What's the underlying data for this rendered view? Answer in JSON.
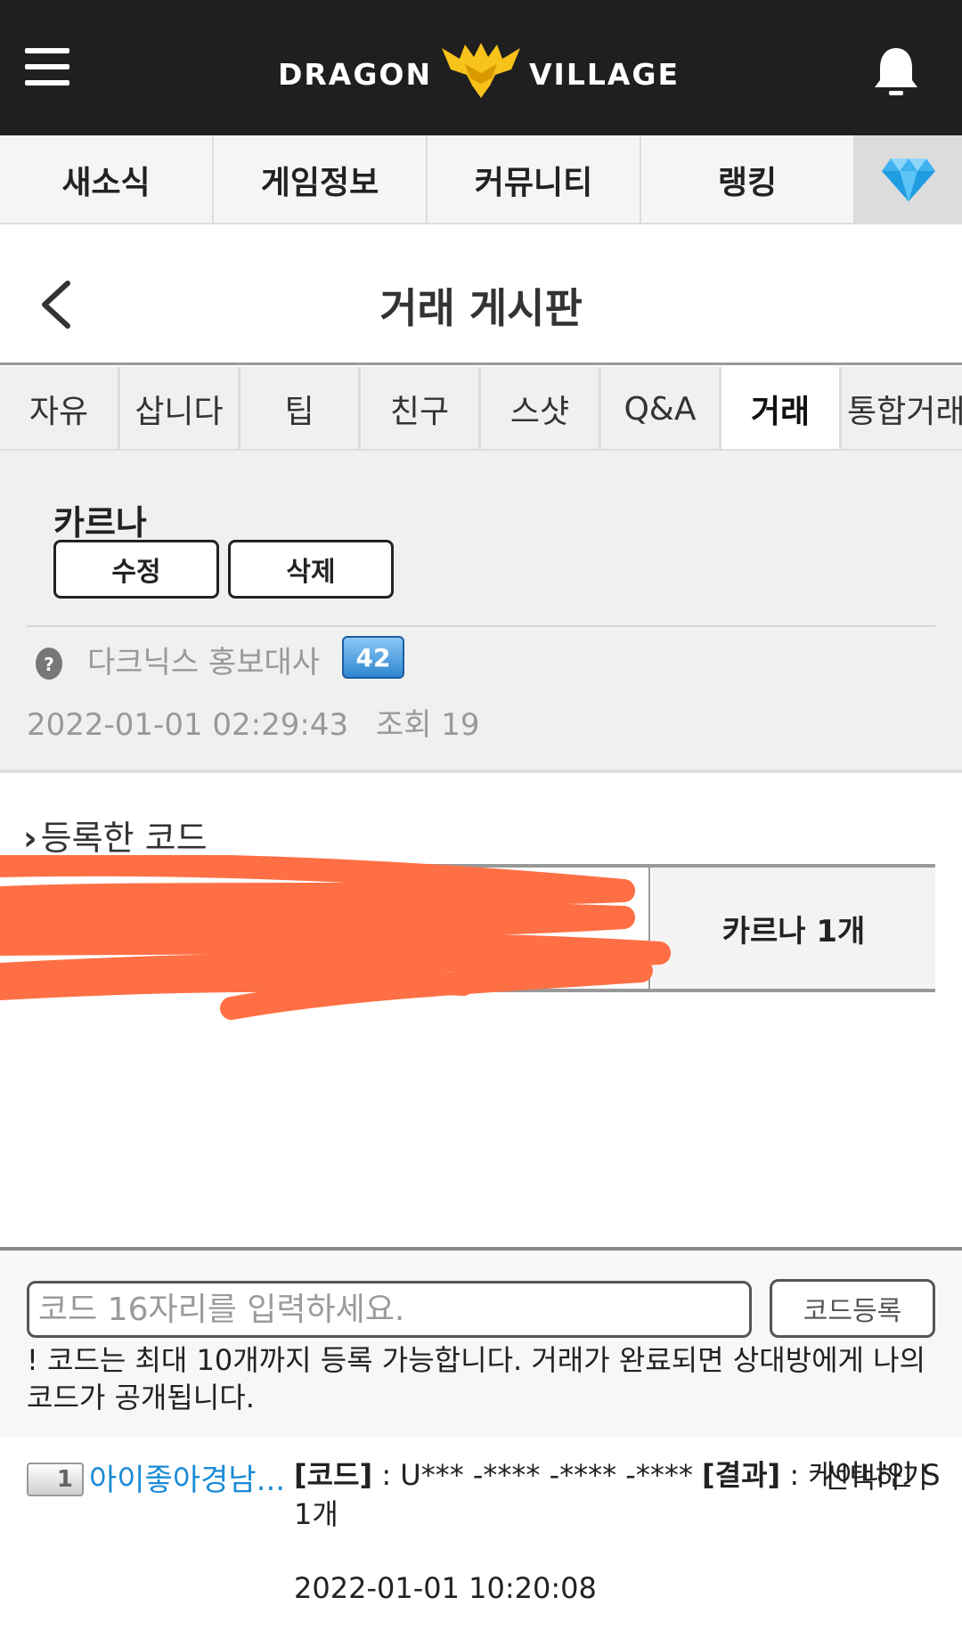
{
  "header": {
    "logo_left": "DRAGON",
    "logo_right": "VILLAGE",
    "colors": {
      "bar": "#1f1f1f",
      "emblem": "#f7c21a",
      "gem": "#3fb2f0"
    }
  },
  "main_nav": {
    "items": [
      "새소식",
      "게임정보",
      "커뮤니티",
      "랭킹"
    ],
    "gem_icon": "diamond-icon"
  },
  "page": {
    "title": "거래 게시판"
  },
  "sub_tabs": {
    "items": [
      "자유",
      "삽니다",
      "팁",
      "친구",
      "스샷",
      "Q&A",
      "거래",
      "통합거래"
    ],
    "active": "거래"
  },
  "post": {
    "title": "카르나",
    "edit_label": "수정",
    "delete_label": "삭제",
    "author": "다크닉스 홍보대사",
    "level": "42",
    "datetime": "2022-01-01 02:29:43",
    "views": "조회 19"
  },
  "registered": {
    "label": "등록한 코드",
    "item": "카르나 1개"
  },
  "code_form": {
    "placeholder": "코드 16자리를 입력하세요.",
    "submit_label": "코드등록",
    "notice": "! 코드는 최대 10개까지 등록 가능합니다. 거래가 완료되면 상대방에게 나의 코드가 공개됩니다."
  },
  "comment": {
    "rank": "1",
    "user": "아이좋아경남...",
    "code_label": "[코드]",
    "code_value": " : U*** -**** -**** -****",
    "result_label": "[결과]",
    "result_value": " : 케이나인 S 1개",
    "select_label": "선택하기",
    "datetime": "2022-01-01 10:20:08"
  }
}
